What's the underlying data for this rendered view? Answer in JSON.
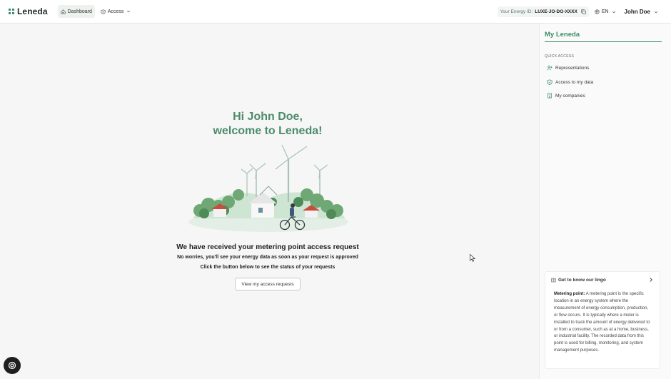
{
  "header": {
    "brand": "Leneda",
    "nav": [
      {
        "label": "Dashboard",
        "icon": "home-icon"
      },
      {
        "label": "Access",
        "icon": "shield-check-icon"
      }
    ],
    "energy_id_label": "Your Energy ID:",
    "energy_id_value": "LUXE-JO-DO-XXXX",
    "language": "EN",
    "user_name": "John Doe"
  },
  "sidebar": {
    "title": "My Leneda",
    "quick_access_label": "QUICK ACCESS",
    "items": [
      {
        "label": "Representations",
        "icon": "user-plus-icon"
      },
      {
        "label": "Access to my data",
        "icon": "shield-check-icon"
      },
      {
        "label": "My companies",
        "icon": "building-icon"
      }
    ]
  },
  "lingo": {
    "title": "Get to know our lingo",
    "term": "Metering point:",
    "definition": "A metering point is the specific location in an energy system where the measurement of energy consumption, production, or flow occurs. It is typically where a meter is installed to track the amount of energy delivered to or from a consumer, such as at a home, business, or industrial facility. The recorded data from this point is used for billing, monitoring, and system management purposes."
  },
  "main": {
    "greeting_line1": "Hi John Doe,",
    "greeting_line2": "welcome to Leneda!",
    "heading": "We have received your metering point access request",
    "subtext1": "No worries, you'll see your energy data as soon as your request is approved",
    "subtext2": "Click the button below to see the status of your requests",
    "button_label": "View my access requests"
  },
  "colors": {
    "accent": "#3f8c6b",
    "greeting": "#4c8c6b",
    "support_button": "#1e1e1e"
  }
}
